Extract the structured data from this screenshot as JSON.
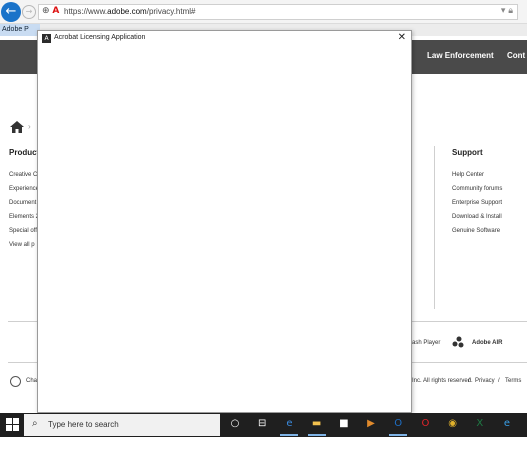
{
  "browser": {
    "back_icon": "back-arrow-icon",
    "forward_icon": "forward-arrow-icon",
    "url_prefix": "https://www.",
    "url_domain": "adobe.com",
    "url_path": "/privacy.html#",
    "tab_title": "Adobe P"
  },
  "site": {
    "nav": {
      "law_enforcement": "Law Enforcement",
      "contact": "Cont"
    },
    "breadcrumb_sep": "›",
    "products": {
      "heading": "Product",
      "links": [
        "Creative C",
        "Experience",
        "Document",
        "Elements 2",
        "Special off",
        "View all p"
      ]
    },
    "support": {
      "heading": "Support",
      "links": [
        "Help Center",
        "Community forums",
        "Enterprise Support",
        "Download & Install",
        "Genuine Software"
      ]
    },
    "footer": {
      "flash_player": "ash Player",
      "adobe_air": "Adobe AIR",
      "change_region": "Cha",
      "rights": "Inc. All rights reserved.",
      "privacy": "Privacy",
      "terms": "Terms",
      "separator": "/"
    }
  },
  "dialog": {
    "title": "Acrobat Licensing Application",
    "icon_label": "A",
    "close_label": "✕"
  },
  "taskbar": {
    "search_placeholder": "Type here to search",
    "icons": [
      {
        "name": "cortana-circle-icon",
        "glyph": "○",
        "color": "#ffffff"
      },
      {
        "name": "task-view-icon",
        "glyph": "⊟",
        "color": "#ffffff"
      },
      {
        "name": "edge-browser-icon",
        "glyph": "e",
        "color": "#3b8be0"
      },
      {
        "name": "file-explorer-icon",
        "glyph": "▬",
        "color": "#f2c14e"
      },
      {
        "name": "store-bag-icon",
        "glyph": "■",
        "color": "#ffffff"
      },
      {
        "name": "media-player-icon",
        "glyph": "▶",
        "color": "#e08a2c"
      },
      {
        "name": "outlook-icon",
        "glyph": "O",
        "color": "#1f6fc5"
      },
      {
        "name": "opera-icon",
        "glyph": "O",
        "color": "#e0242a"
      },
      {
        "name": "chrome-icon",
        "glyph": "◉",
        "color": "#e0b12c"
      },
      {
        "name": "excel-icon",
        "glyph": "X",
        "color": "#1e7a44"
      },
      {
        "name": "internet-explorer-icon",
        "glyph": "e",
        "color": "#3aa0e8"
      }
    ]
  },
  "colors": {
    "nav_bg": "#4a4a4a",
    "taskbar_bg": "#1f1f1f",
    "back_button": "#1a73c9",
    "adobe_red": "#d11111"
  }
}
